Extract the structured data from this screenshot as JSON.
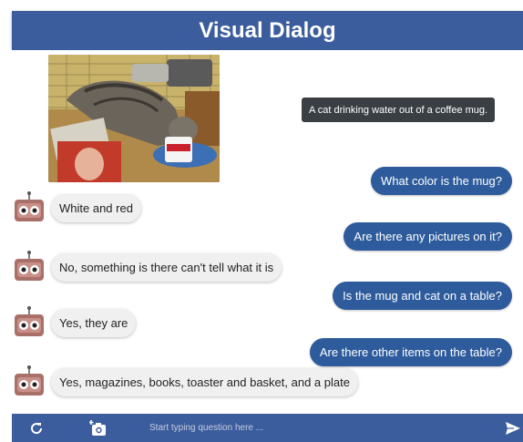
{
  "app": {
    "title": "Visual Dialog"
  },
  "image": {
    "alt": "cat drinking from mug on table",
    "icon": "photo"
  },
  "caption": {
    "text": "A cat drinking water out of a coffee mug."
  },
  "dialog": [
    {
      "question": "What color is the mug?",
      "answer": "White and red"
    },
    {
      "question": "Are there any pictures on it?",
      "answer": "No, something is there can't tell what it is"
    },
    {
      "question": "Is the mug and cat on a table?",
      "answer": "Yes, they are"
    },
    {
      "question": "Are there other items on the table?",
      "answer": "Yes, magazines, books, toaster and basket, and a plate"
    }
  ],
  "footer": {
    "refresh_icon": "refresh-icon",
    "add_photo_icon": "add-photo-icon",
    "input_placeholder": "Start typing question here ...",
    "send_icon": "send-icon"
  },
  "colors": {
    "header": "#3c5d9d",
    "question_bubble": "#2d5b9c",
    "answer_bubble": "#f0f0f0",
    "caption_bg": "#3a3f44"
  }
}
